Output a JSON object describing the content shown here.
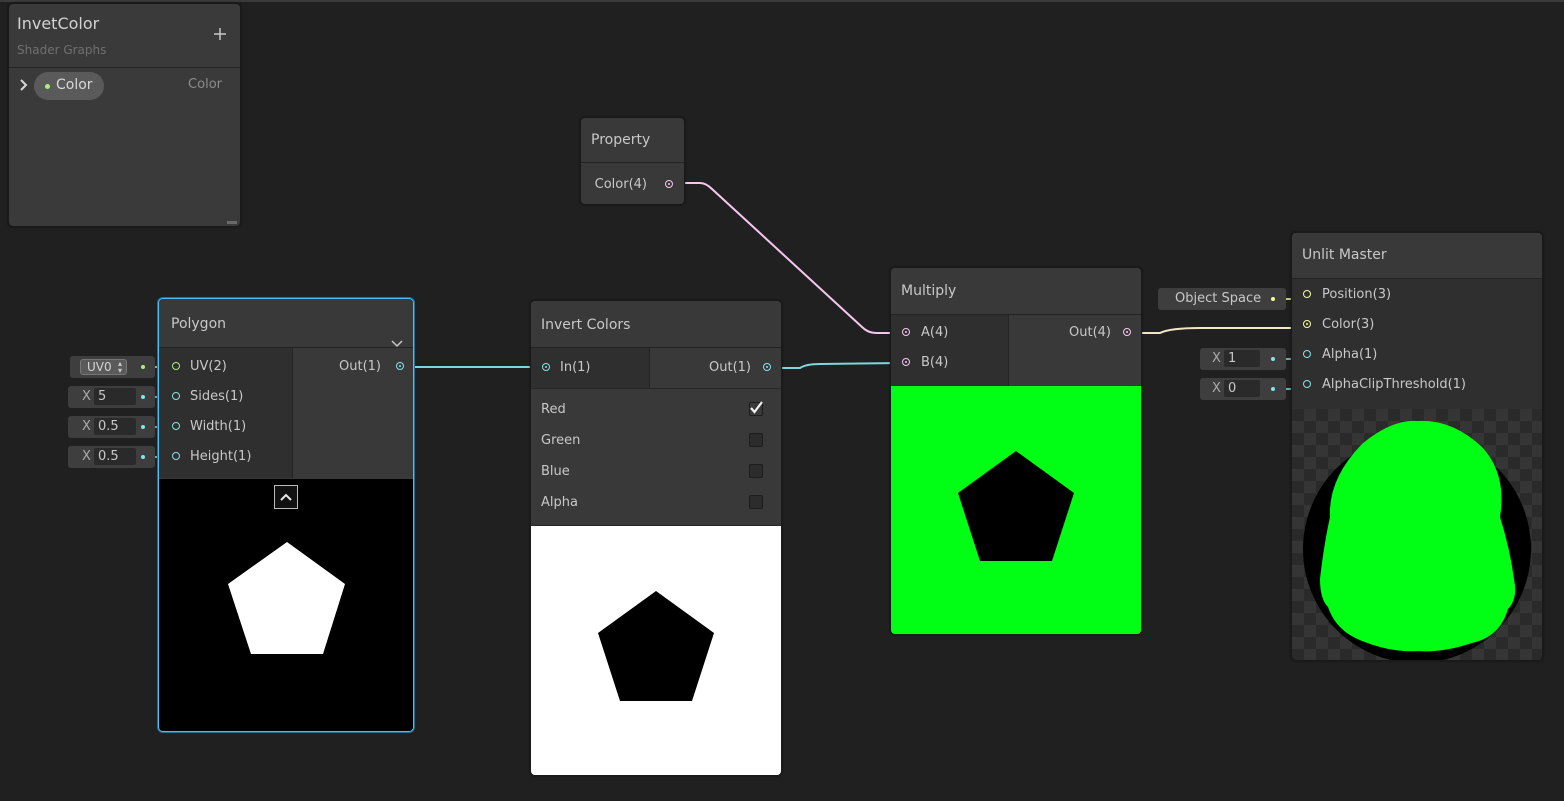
{
  "blackboard": {
    "title": "InvetColor",
    "subtitle": "Shader Graphs",
    "add_icon": "plus-icon",
    "property_name": "Color",
    "property_type": "Color"
  },
  "property_node": {
    "title": "Property",
    "output": "Color(4)"
  },
  "polygon_node": {
    "title": "Polygon",
    "inputs": [
      "UV(2)",
      "Sides(1)",
      "Width(1)",
      "Height(1)"
    ],
    "output": "Out(1)",
    "uv_value": "UV0",
    "sides_value": "5",
    "width_value": "0.5",
    "height_value": "0.5",
    "axis_label": "X"
  },
  "invert_node": {
    "title": "Invert Colors",
    "input": "In(1)",
    "output": "Out(1)",
    "channels": [
      {
        "label": "Red",
        "checked": true
      },
      {
        "label": "Green",
        "checked": false
      },
      {
        "label": "Blue",
        "checked": false
      },
      {
        "label": "Alpha",
        "checked": false
      }
    ]
  },
  "multiply_node": {
    "title": "Multiply",
    "input_a": "A(4)",
    "input_b": "B(4)",
    "output": "Out(4)"
  },
  "master_node": {
    "title": "Unlit Master",
    "inputs": [
      "Position(3)",
      "Color(3)",
      "Alpha(1)",
      "AlphaClipThreshold(1)"
    ],
    "position_space": "Object Space",
    "alpha_value": "1",
    "clip_value": "0",
    "axis_label": "X"
  },
  "colors": {
    "background": "#202020",
    "node_body": "#393939",
    "wire_float": "#84e4e7",
    "wire_vector4": "#fbcbf4",
    "wire_vector3": "#f6ff9a",
    "preview_green": "#00ff14",
    "selection": "#44c0ff"
  }
}
